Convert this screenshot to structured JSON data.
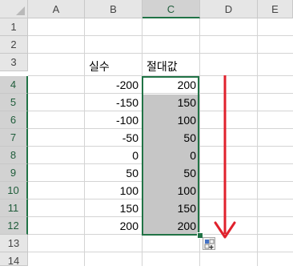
{
  "columns": [
    "A",
    "B",
    "C",
    "D",
    "E"
  ],
  "rows": [
    "1",
    "2",
    "3",
    "4",
    "5",
    "6",
    "7",
    "8",
    "9",
    "10",
    "11",
    "12",
    "13",
    "14"
  ],
  "headers": {
    "b3": "실수",
    "c3": "절대값"
  },
  "values": {
    "b": [
      "-200",
      "-150",
      "-100",
      "-50",
      "0",
      "50",
      "100",
      "150",
      "200"
    ],
    "c": [
      "200",
      "150",
      "100",
      "50",
      "0",
      "50",
      "100",
      "150",
      "200"
    ]
  },
  "colors": {
    "selection_border": "#217346",
    "selection_fill": "#c6c6c6",
    "arrow": "#e0212c"
  },
  "icons": {
    "quick_analysis": "quick-analysis-icon",
    "arrow": "arrow-down-icon"
  }
}
